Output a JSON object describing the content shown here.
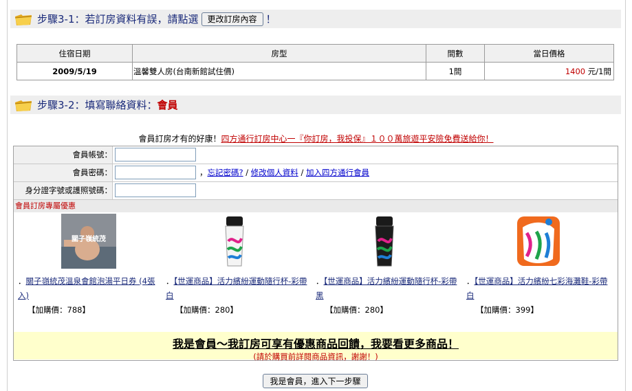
{
  "step1": {
    "title": "步驟3-1：若訂房資料有誤，請點選",
    "button": "更改訂房內容",
    "suffix": "！"
  },
  "booking": {
    "headers": [
      "住宿日期",
      "房型",
      "間數",
      "當日價格"
    ],
    "row": {
      "date": "2009/5/19",
      "room": "溫馨雙人房(台南新館試住價)",
      "qty": "1間",
      "price": "1400",
      "price_unit": "元/1間"
    }
  },
  "step2": {
    "title": "步驟3-2：填寫聯絡資料：",
    "member": "會員"
  },
  "promo": {
    "lead": "會員訂房才有的好康！",
    "link": "四方通行訂房中心一『你訂房，我投保』１００萬旅遊平安險免費送給你！"
  },
  "form": {
    "account_label": "會員帳號：",
    "password_label": "會員密碼：",
    "id_label": "身分證字號或護照號碼：",
    "sep": "，",
    "forgot": "忘記密碼?",
    "slash1": " / ",
    "edit": "修改個人資料",
    "slash2": " / ",
    "join": "加入四方通行會員"
  },
  "special_head": "會員訂房專屬優惠",
  "products": [
    {
      "bullet": "．",
      "title": "關子嶺統茂溫泉會館泡湯平日券 (4張入)",
      "price": "【加購價：788】",
      "img_text": "關子嶺統茂"
    },
    {
      "bullet": "．",
      "title": "【世運商品】活力繽紛運動隨行杯-彩帶白",
      "price": "【加購價：280】"
    },
    {
      "bullet": "．",
      "title": "【世運商品】活力繽紛運動隨行杯-彩帶黑",
      "price": "【加購價：280】"
    },
    {
      "bullet": "．",
      "title": "【世運商品】活力繽紛七彩海灘鞋-彩帶白",
      "price": "【加購價：399】"
    }
  ],
  "banner": {
    "main": "我是會員～我訂房可享有優惠商品回饋，我要看更多商品！",
    "sub": "(請於購買前詳閱商品資訊，謝謝！)"
  },
  "next_button": "我是會員，進入下一步驟",
  "colors": {
    "accent_red": "#c00000",
    "link_blue": "#0000cc",
    "step_text": "#1a2a7a",
    "banner_bg": "#ffffcc"
  }
}
